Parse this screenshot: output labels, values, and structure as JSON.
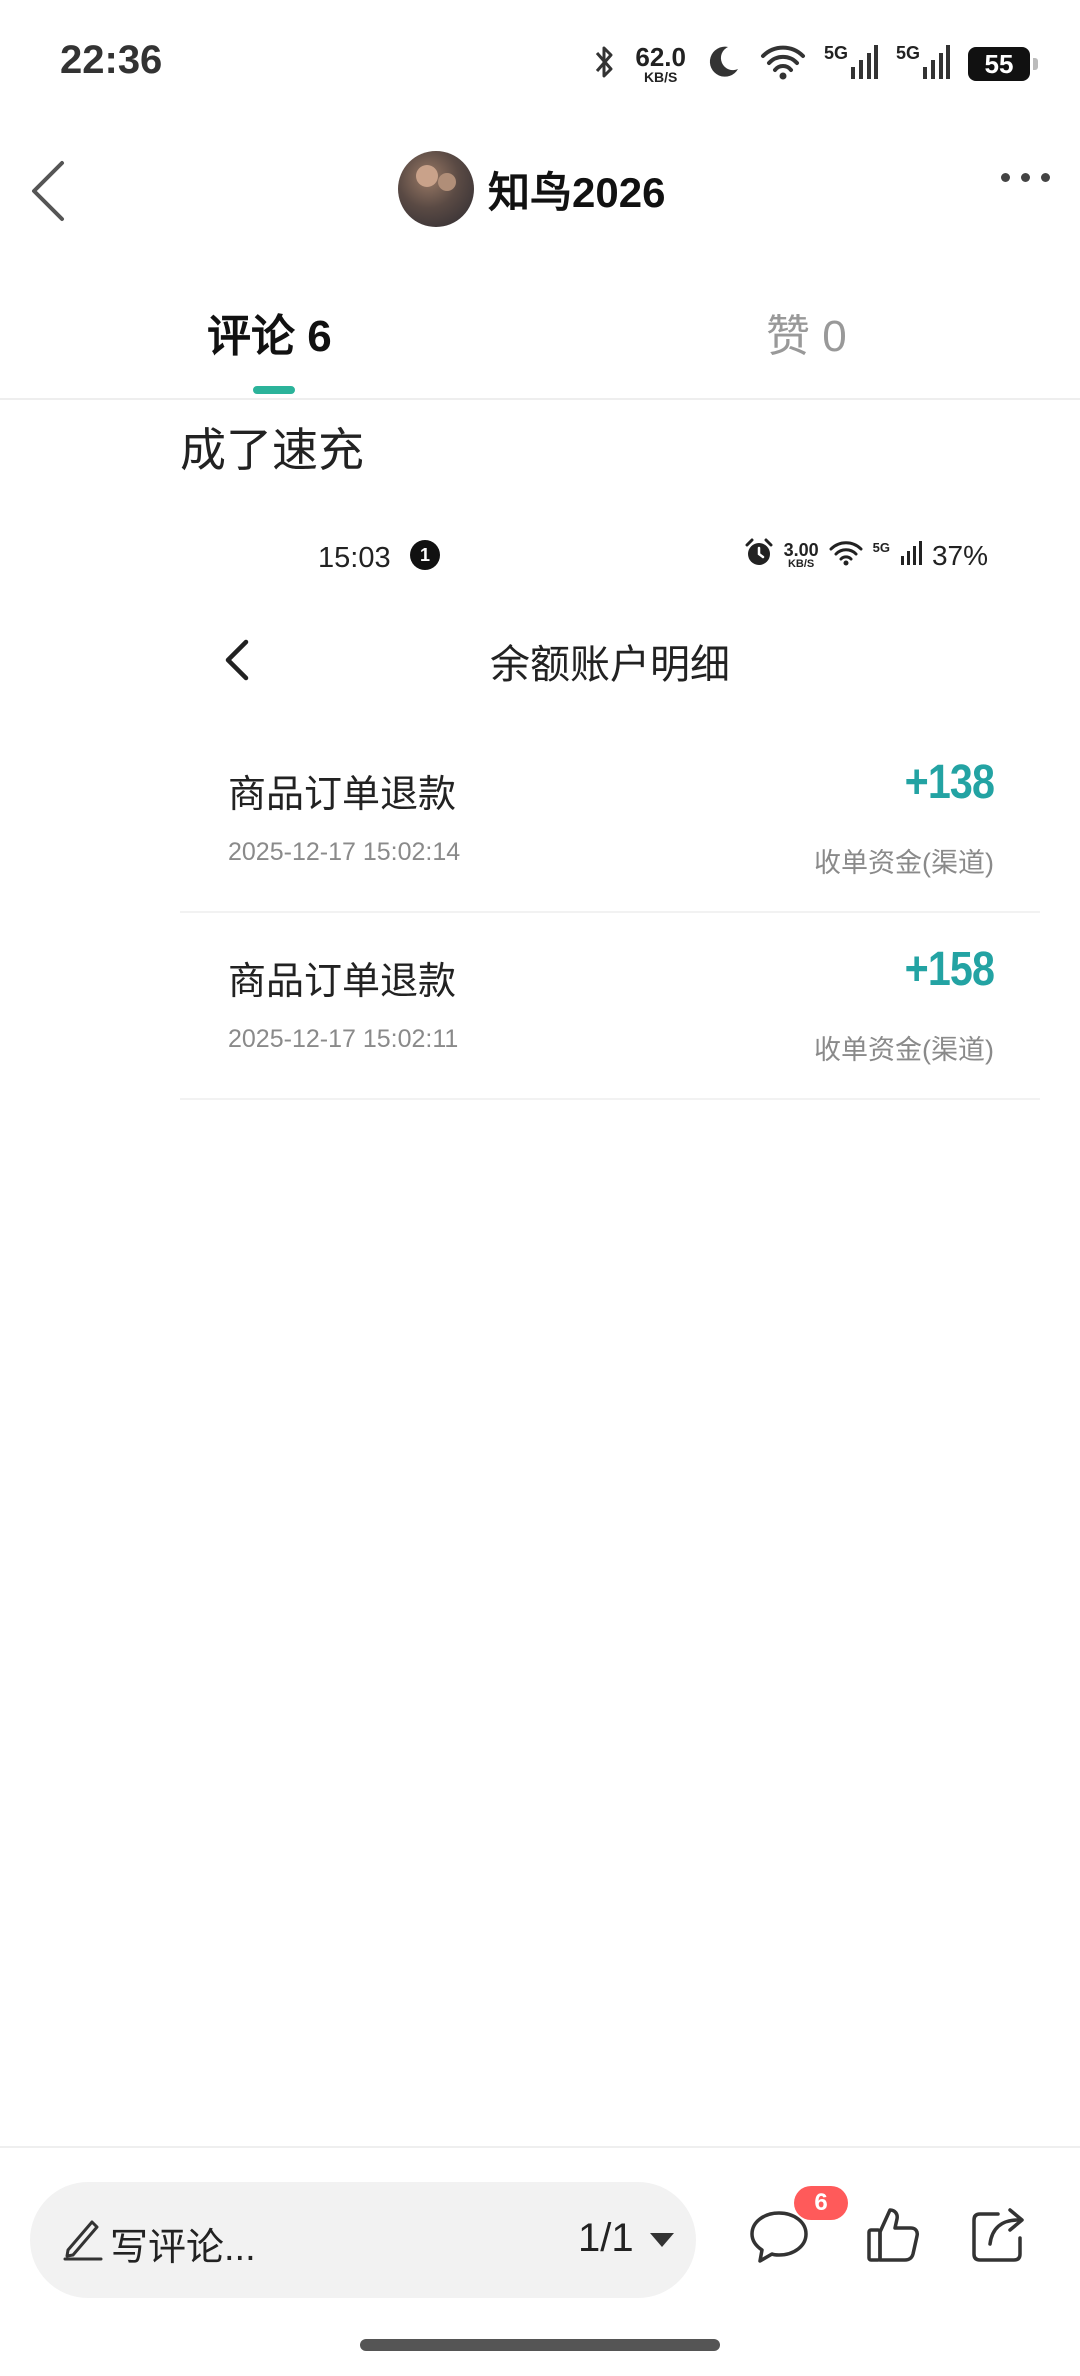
{
  "status_bar": {
    "time": "22:36",
    "net_speed": "62.0",
    "net_speed_unit": "KB/S",
    "net_tag_1": "5G",
    "net_tag_2": "5G",
    "battery": "55",
    "icons": [
      "bluetooth-icon",
      "moon-icon",
      "wifi-icon",
      "signal-icon",
      "signal-icon",
      "battery-icon"
    ]
  },
  "header": {
    "username": "知鸟2026",
    "icons": [
      "back-arrow-icon",
      "avatar",
      "more-icon"
    ]
  },
  "tabs": [
    {
      "label": "评论 6",
      "active": true
    },
    {
      "label": "赞 0",
      "active": false
    }
  ],
  "accent_color": "#2bb39a",
  "comment": {
    "text": "成了速充"
  },
  "embedded_screenshot": {
    "status_bar": {
      "time": "15:03",
      "notification_count": "1",
      "net_speed": "3.00",
      "net_speed_unit": "KB/S",
      "net_tag": "5G",
      "battery": "37%"
    },
    "title": "余额账户明细",
    "amount_color": "#23a3a3",
    "transactions": [
      {
        "title": "商品订单退款",
        "date": "2025-12-17 15:02:14",
        "amount": "+138",
        "channel": "收单资金(渠道)"
      },
      {
        "title": "商品订单退款",
        "date": "2025-12-17 15:02:11",
        "amount": "+158",
        "channel": "收单资金(渠道)"
      }
    ]
  },
  "bottom_bar": {
    "write_placeholder": "写评论...",
    "pager": "1/1",
    "comment_badge": "6",
    "badge_color": "#ff5a5a",
    "icons": [
      "pencil-icon",
      "chevron-down-icon",
      "comment-icon",
      "thumbs-up-icon",
      "share-icon"
    ]
  }
}
